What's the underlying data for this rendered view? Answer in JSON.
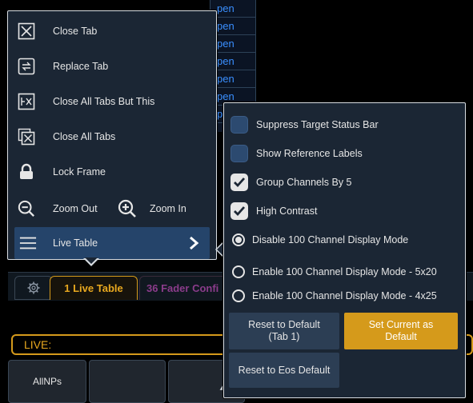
{
  "background": {
    "grid_cells": [
      "pen",
      "pen",
      "pen",
      "pen",
      "p"
    ],
    "tabs": {
      "gear_icon": "gear-icon",
      "live_tab": "1 Live Table",
      "fader_tab": "36 Fader Confi"
    },
    "live_label": "LIVE:",
    "softkeys": [
      {
        "label": "AllNPs"
      },
      {
        "label": ""
      },
      {
        "label": "",
        "icon": "triangle-up-icon"
      }
    ]
  },
  "menu": {
    "items": [
      {
        "label": "Close Tab",
        "icon": "close-tab-icon"
      },
      {
        "label": "Replace Tab",
        "icon": "replace-tab-icon"
      },
      {
        "label": "Close All Tabs But This",
        "icon": "close-others-icon"
      },
      {
        "label": "Close All Tabs",
        "icon": "close-all-icon"
      },
      {
        "label": "Lock Frame",
        "icon": "lock-icon"
      }
    ],
    "zoom_out": {
      "label": "Zoom Out",
      "icon": "zoom-out-icon"
    },
    "zoom_in": {
      "label": "Zoom In",
      "icon": "zoom-in-icon"
    },
    "live_table": {
      "label": "Live Table",
      "icon": "hamburger-icon"
    }
  },
  "submenu": {
    "checkboxes": [
      {
        "label": "Suppress Target Status Bar",
        "checked": false
      },
      {
        "label": "Show Reference Labels",
        "checked": false
      },
      {
        "label": "Group Channels By 5",
        "checked": true
      },
      {
        "label": "High Contrast",
        "checked": true
      }
    ],
    "radios": [
      {
        "label": "Disable 100 Channel Display Mode",
        "selected": true
      },
      {
        "label": "Enable 100 Channel Display Mode - 5x20",
        "selected": false
      },
      {
        "label": "Enable 100 Channel Display Mode - 4x25",
        "selected": false
      }
    ],
    "buttons": {
      "reset_default": "Reset to Default\n(Tab 1)",
      "set_current": "Set Current as\nDefault",
      "reset_eos": "Reset to Eos Default"
    }
  },
  "colors": {
    "accent_gold": "#d59a1b",
    "menu_bg": "#1b2634",
    "highlight_blue": "#25446a",
    "link_blue": "#3a8fff"
  }
}
